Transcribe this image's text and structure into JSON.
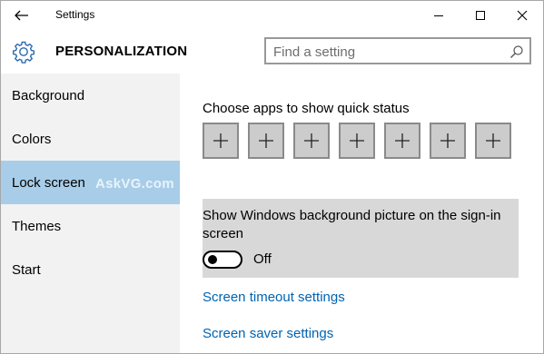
{
  "window": {
    "title": "Settings",
    "controls": [
      "minimize",
      "maximize",
      "close"
    ]
  },
  "header": {
    "section_title": "PERSONALIZATION",
    "search_placeholder": "Find a setting",
    "icons": {
      "section": "gear-icon",
      "search": "search-icon"
    }
  },
  "sidebar": {
    "items": [
      {
        "label": "Background",
        "active": false
      },
      {
        "label": "Colors",
        "active": false
      },
      {
        "label": "Lock screen",
        "active": true
      },
      {
        "label": "Themes",
        "active": false
      },
      {
        "label": "Start",
        "active": false
      }
    ],
    "watermark": "AskVG.com"
  },
  "main": {
    "quick_status_label": "Choose apps to show quick status",
    "quick_status_slots": 7,
    "signin_label": "Show Windows background picture on the sign-in screen",
    "signin_toggle_state": "Off",
    "links": {
      "screen_timeout": "Screen timeout settings",
      "screen_saver": "Screen saver settings"
    }
  },
  "colors": {
    "accent": "#0063b1",
    "active_nav": "#a8cde8",
    "sidebar_bg": "#f2f2f2",
    "panel_bg": "#d8d8d8"
  }
}
